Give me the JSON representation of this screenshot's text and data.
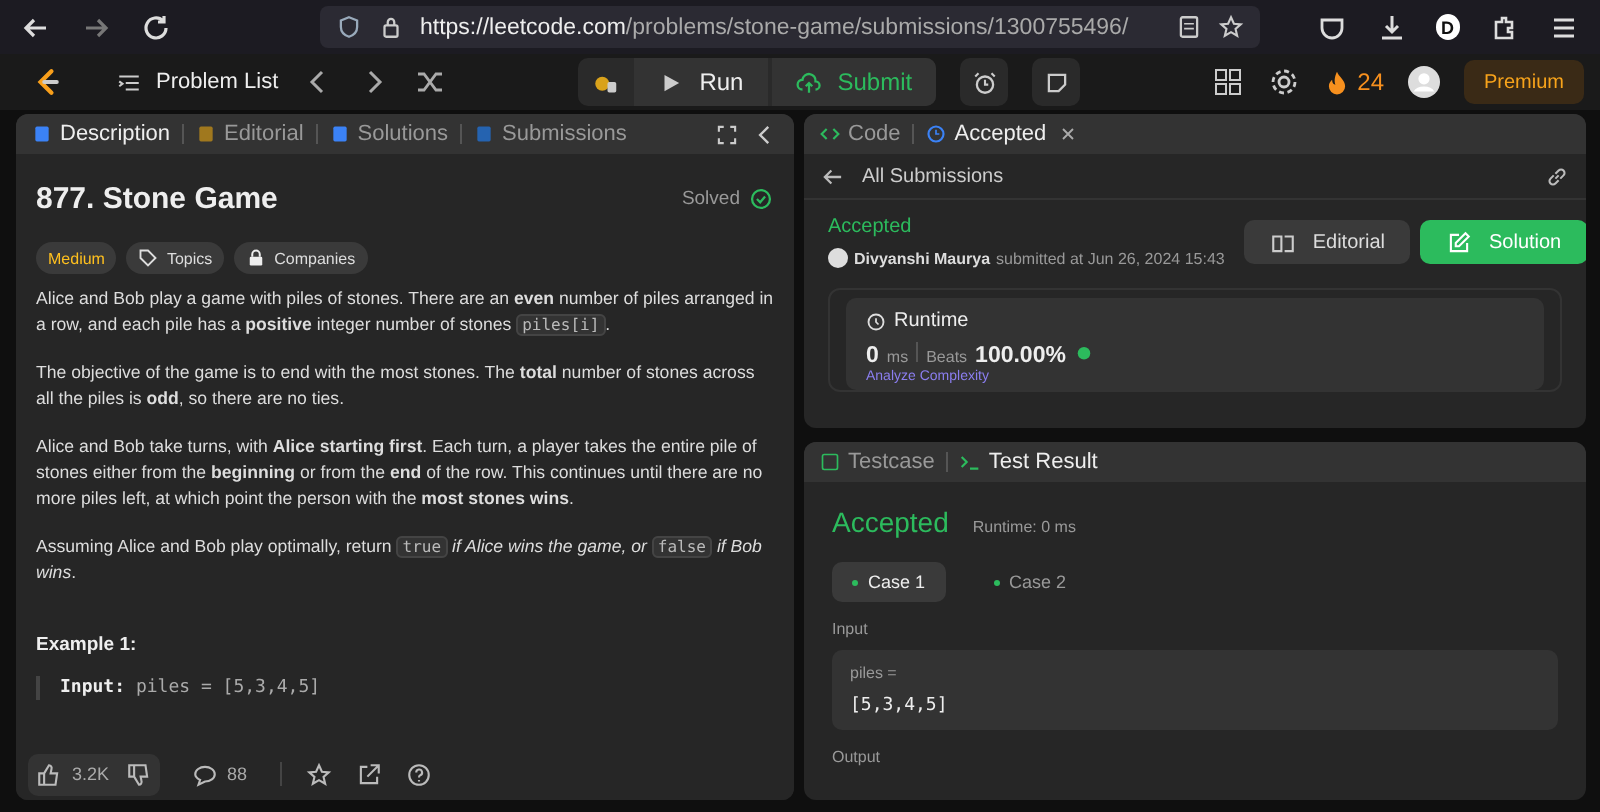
{
  "browser": {
    "url_host": "https://leetcode.com",
    "url_path": "/problems/stone-game/submissions/1300755496/",
    "profile": "D"
  },
  "nav": {
    "problem_list": "Problem List",
    "run": "Run",
    "submit": "Submit",
    "streak": "24",
    "premium": "Premium"
  },
  "left_tabs": [
    {
      "label": "Description",
      "selected": true
    },
    {
      "label": "Editorial",
      "selected": false
    },
    {
      "label": "Solutions",
      "selected": false
    },
    {
      "label": "Submissions",
      "selected": false
    }
  ],
  "problem": {
    "title": "877. Stone Game",
    "status": "Solved",
    "difficulty": "Medium",
    "tags": [
      "Topics",
      "Companies"
    ],
    "paragraphs": [
      [
        {
          "kind": "text",
          "text": "Alice and Bob play a game with piles of stones. There are an **even** number of piles arranged in a row, and each pile has a **positive** integer number of stones "
        },
        {
          "kind": "code",
          "text": "piles[i]"
        },
        {
          "kind": "text",
          "text": "."
        }
      ],
      [
        {
          "kind": "text",
          "text": "The objective of the game is to end with the most stones. The **total** number of stones across all the piles is **odd**, so there are no ties."
        }
      ],
      [
        {
          "kind": "text",
          "text": "Alice and Bob take turns, with **Alice starting first**. Each turn, a player takes the entire pile of stones either from the **beginning** or from the **end** of the row. This continues until there are no more piles left, at which point the person with the **most stones wins**."
        }
      ],
      [
        {
          "kind": "text",
          "text": "Assuming Alice and Bob play optimally, return "
        },
        {
          "kind": "code",
          "text": "true"
        },
        {
          "kind": "text",
          "text": " *if Alice wins the game, or* "
        },
        {
          "kind": "code",
          "text": "false"
        },
        {
          "kind": "text",
          "text": " *if Bob wins*."
        }
      ]
    ],
    "example_title": "Example 1:",
    "example_label": "Input:",
    "example_value": "piles = [5,3,4,5]",
    "likes": "3.2K",
    "comments": "88"
  },
  "right_tabs": [
    {
      "label": "Code",
      "selected": false
    },
    {
      "label": "Accepted",
      "selected": true
    }
  ],
  "submission": {
    "back": "All Submissions",
    "status": "Accepted",
    "user": "Divyanshi Maurya",
    "submitted": "submitted at Jun 26, 2024 15:43",
    "editorial": "Editorial",
    "solution": "Solution",
    "runtime_title": "Runtime",
    "runtime_value": "0",
    "runtime_unit": "ms",
    "beats_label": "Beats",
    "beats_value": "100.00%",
    "analyze": "Analyze Complexity"
  },
  "bottom_tabs": [
    {
      "label": "Testcase",
      "selected": false
    },
    {
      "label": "Test Result",
      "selected": true
    }
  ],
  "result": {
    "status": "Accepted",
    "runtime": "Runtime: 0 ms",
    "cases": [
      {
        "label": "Case 1",
        "selected": true
      },
      {
        "label": "Case 2",
        "selected": false
      }
    ],
    "input_label": "Input",
    "var_name": "piles =",
    "var_value": "[5,3,4,5]",
    "output_label": "Output"
  }
}
